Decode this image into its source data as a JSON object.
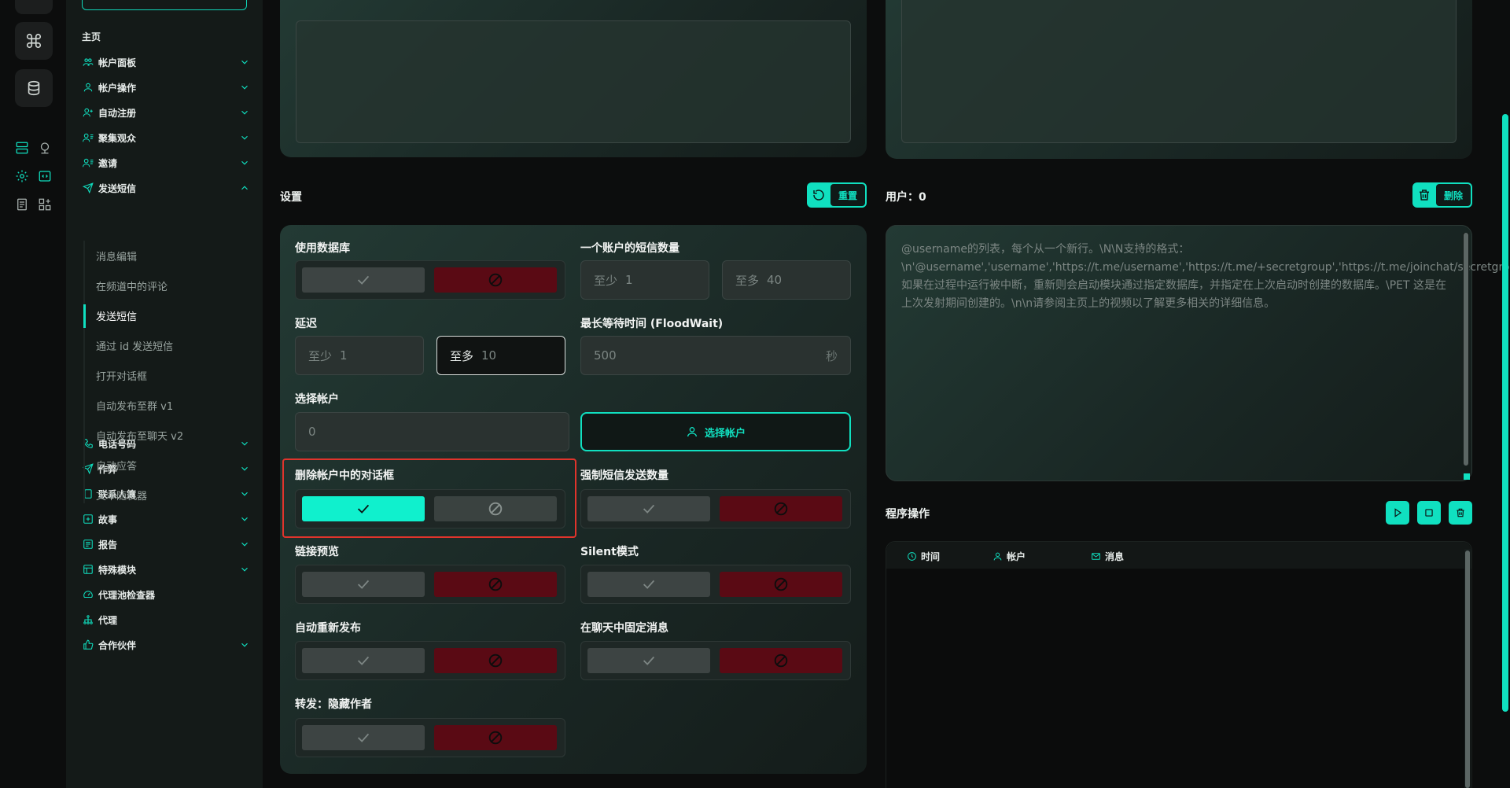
{
  "colors": {
    "accent": "#10e0c0",
    "danger": "#5a0a14",
    "highlight": "#e0342c"
  },
  "sidebar": {
    "section": "主页",
    "items": [
      {
        "label": "帐户面板",
        "icon": "users-icon",
        "expandable": true
      },
      {
        "label": "帐户操作",
        "icon": "user-icon",
        "expandable": true
      },
      {
        "label": "自动注册",
        "icon": "user-plus-icon",
        "expandable": true
      },
      {
        "label": "聚集观众",
        "icon": "user-list-icon",
        "expandable": true
      },
      {
        "label": "邀请",
        "icon": "user-list-icon",
        "expandable": true
      },
      {
        "label": "发送短信",
        "icon": "send-icon",
        "expandable": true,
        "expanded": true
      },
      {
        "label": "电话号码",
        "icon": "phone-icon",
        "expandable": true
      },
      {
        "label": "作弊",
        "icon": "send-icon",
        "expandable": true
      },
      {
        "label": "联系人簿",
        "icon": "contacts-icon",
        "expandable": true
      },
      {
        "label": "故事",
        "icon": "plus-square-icon",
        "expandable": true
      },
      {
        "label": "报告",
        "icon": "report-icon",
        "expandable": true
      },
      {
        "label": "特殊模块",
        "icon": "module-icon",
        "expandable": true
      },
      {
        "label": "代理池检查器",
        "icon": "gauge-icon",
        "expandable": false
      },
      {
        "label": "代理",
        "icon": "network-icon",
        "expandable": false
      },
      {
        "label": "合作伙伴",
        "icon": "thumb-icon",
        "expandable": true
      }
    ],
    "sub_items": [
      {
        "label": "消息编辑",
        "active": false
      },
      {
        "label": "在频道中的评论",
        "active": false
      },
      {
        "label": "发送短信",
        "active": true
      },
      {
        "label": "通过 id 发送短信",
        "active": false
      },
      {
        "label": "打开对话框",
        "active": false
      },
      {
        "label": "自动发布至群 v1",
        "active": false
      },
      {
        "label": "自动发布至聊天 v2",
        "active": false
      },
      {
        "label": "自动应答",
        "active": false
      },
      {
        "label": "文本随机器",
        "active": false
      }
    ]
  },
  "settings": {
    "title": "设置",
    "reset_label": "重置",
    "use_database": {
      "label": "使用数据库",
      "value": false
    },
    "sms_per_account": {
      "label": "一个账户的短信数量",
      "min_prefix": "至少",
      "min_value": "1",
      "max_prefix": "至多",
      "max_value": "40"
    },
    "delay": {
      "label": "延迟",
      "min_prefix": "至少",
      "min_value": "1",
      "max_prefix": "至多",
      "max_value": "10"
    },
    "flood_wait": {
      "label": "最长等待时间 (FloodWait)",
      "value": "500",
      "unit": "秒"
    },
    "select_accounts": {
      "label": "选择帐户",
      "value": "0",
      "button": "选择帐户"
    },
    "delete_dialogs": {
      "label": "删除帐户中的对话框",
      "value": true
    },
    "force_sms_count": {
      "label": "强制短信发送数量",
      "value": false
    },
    "link_preview": {
      "label": "链接预览",
      "value": false
    },
    "silent_mode": {
      "label": "Silent模式",
      "value": false
    },
    "auto_repost": {
      "label": "自动重新发布",
      "value": false
    },
    "pin_message": {
      "label": "在聊天中固定消息",
      "value": false
    },
    "forward_hide": {
      "label": "转发：隐藏作者",
      "value": false
    }
  },
  "users": {
    "title": "用户：0",
    "delete_label": "删除",
    "placeholder": "@username的列表，每个从一个新行。\\N\\N支持的格式：\\n'@username','username','https://t.me/username','https://t.me/+secretgroup','https://t.me/joinchat/secretgroup'.\\n\\n如果在过程中运行被中断，重新则会启动模块通过指定数据库，并指定在上次启动时创建的数据库。\\PET 这是在上次发射期间创建的。\\n\\n请参阅主页上的视频以了解更多相关的详细信息。"
  },
  "process": {
    "title": "程序操作",
    "columns": [
      "时间",
      "帐户",
      "消息"
    ]
  }
}
